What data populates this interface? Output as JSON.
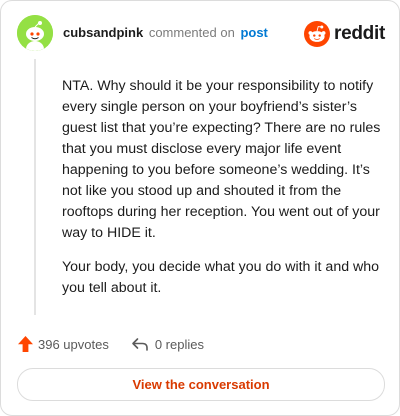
{
  "comment": {
    "username": "cubsandpink",
    "action_text": "commented on",
    "post_link_text": "post",
    "paragraphs": [
      "NTA. Why should it be your responsibility to notify every single person on your boyfriend’s sister’s guest list that you’re expecting? There are no rules that you must disclose every major life event happening to you before someone’s wedding. It’s not like you stood up and shouted it from the rooftops during her reception. You went out of your way to HIDE it.",
      "Your body, you decide what you do with it and who you tell about it."
    ]
  },
  "brand": {
    "wordmark": "reddit",
    "accent_color": "#ff4500",
    "link_color": "#0079d3",
    "button_text_color": "#d93a00"
  },
  "footer": {
    "upvotes_label": "396 upvotes",
    "replies_label": "0 replies",
    "upvote_icon": "upvote-arrow-icon",
    "reply_icon": "reply-icon"
  },
  "cta": {
    "label": "View the conversation"
  }
}
